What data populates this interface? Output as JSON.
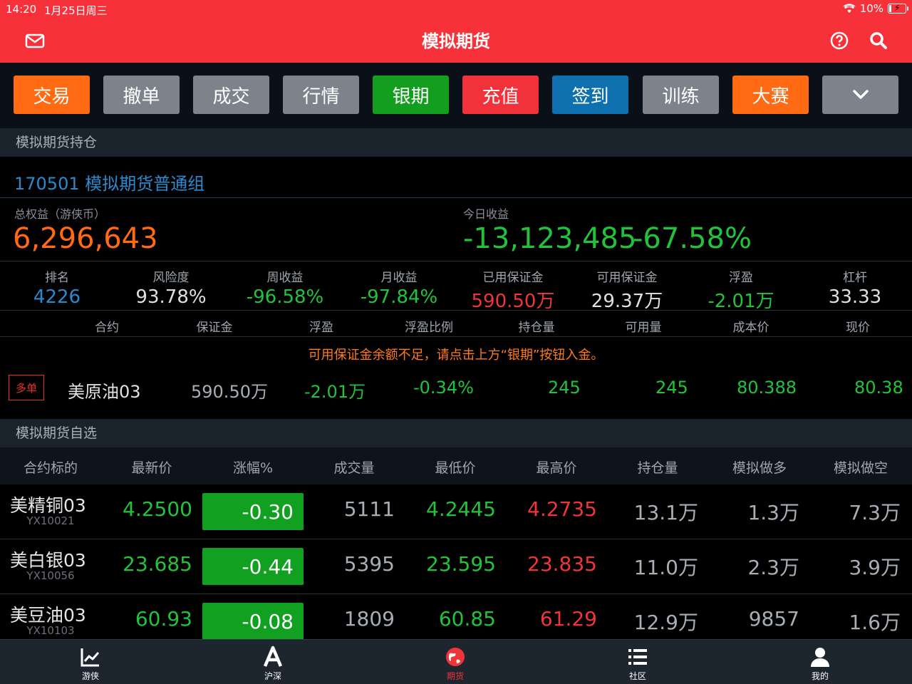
{
  "status": {
    "time": "14:20",
    "date": "1月25日周三",
    "battery": "10%",
    "battery_level": 0.1
  },
  "header": {
    "title": "模拟期货",
    "left_icon": "mail-icon",
    "right_icons": [
      "help-icon",
      "search-icon"
    ]
  },
  "actions": [
    {
      "label": "交易",
      "color": "#ff6a12"
    },
    {
      "label": "撤单",
      "color": "#7c838b"
    },
    {
      "label": "成交",
      "color": "#7c838b"
    },
    {
      "label": "行情",
      "color": "#7c838b"
    },
    {
      "label": "银期",
      "color": "#149e20"
    },
    {
      "label": "充值",
      "color": "#f2323a"
    },
    {
      "label": "签到",
      "color": "#0f70b0"
    },
    {
      "label": "训练",
      "color": "#7c838b"
    },
    {
      "label": "大赛",
      "color": "#ff6a12"
    },
    {
      "label": "",
      "color": "#7c838b",
      "icon": "chevron-down-icon"
    }
  ],
  "holdings": {
    "section_title": "模拟期货持仓",
    "account": "170501  模拟期货普通组",
    "equity_label": "总权益（游侠币）",
    "equity_value": "6,296,643",
    "today_label": "今日收益",
    "today_value": "-13,123,485",
    "today_pct": "-67.58%",
    "stats": [
      {
        "label": "排名",
        "value": "4226"
      },
      {
        "label": "风险度",
        "value": "93.78%"
      },
      {
        "label": "周收益",
        "value": "-96.58%"
      },
      {
        "label": "月收益",
        "value": "-97.84%"
      },
      {
        "label": "已用保证金",
        "value": "590.50万"
      },
      {
        "label": "可用保证金",
        "value": "29.37万"
      },
      {
        "label": "浮盈",
        "value": "-2.01万"
      },
      {
        "label": "杠杆",
        "value": "33.33"
      }
    ],
    "columns": [
      "合约",
      "保证金",
      "浮盈",
      "浮盈比例",
      "持仓量",
      "可用量",
      "成本价",
      "现价"
    ],
    "notice": "可用保证金余额不足，请点击上方“银期”按钮入金。",
    "position": {
      "tag": "多单",
      "contract": "美原油03",
      "margin": "590.50万",
      "float_pl": "-2.01万",
      "float_pct": "-0.34%",
      "qty": "245",
      "avail": "245",
      "cost": "80.388",
      "price": "80.38"
    }
  },
  "watchlist": {
    "section_title": "模拟期货自选",
    "columns": [
      "合约标的",
      "最新价",
      "涨幅%",
      "成交量",
      "最低价",
      "最高价",
      "持仓量",
      "模拟做多",
      "模拟做空"
    ],
    "rows": [
      {
        "name": "美精铜03",
        "code": "YX10021",
        "last": "4.2500",
        "chg": "-0.30",
        "vol": "5111",
        "low": "4.2445",
        "high": "4.2735",
        "oi": "13.1万",
        "long": "1.3万",
        "short": "7.3万"
      },
      {
        "name": "美白银03",
        "code": "YX10056",
        "last": "23.685",
        "chg": "-0.44",
        "vol": "5395",
        "low": "23.595",
        "high": "23.835",
        "oi": "11.0万",
        "long": "2.3万",
        "short": "3.9万"
      },
      {
        "name": "美豆油03",
        "code": "YX10103",
        "last": "60.93",
        "chg": "-0.08",
        "vol": "1809",
        "low": "60.85",
        "high": "61.29",
        "oi": "12.9万",
        "long": "9857",
        "short": "1.6万"
      }
    ]
  },
  "tabs": [
    {
      "label": "游侠",
      "icon": "chart-icon"
    },
    {
      "label": "沪深",
      "icon": "letter-a-icon"
    },
    {
      "label": "期货",
      "icon": "globe-icon",
      "active": true
    },
    {
      "label": "社区",
      "icon": "list-icon"
    },
    {
      "label": "我的",
      "icon": "user-icon"
    }
  ],
  "colors": {
    "header": "#f7313a",
    "up": "#f0353a",
    "down": "#22c33a",
    "accent": "#2a8ad0"
  }
}
